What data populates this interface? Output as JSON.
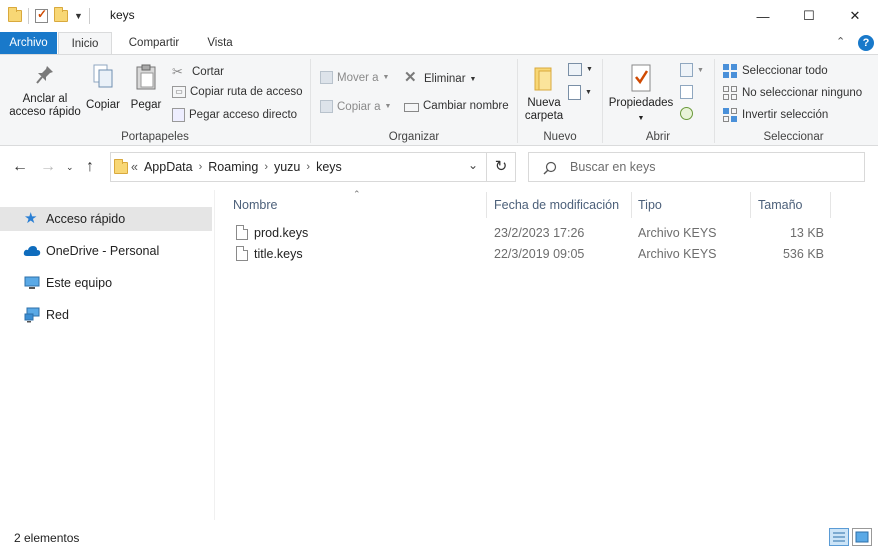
{
  "window": {
    "title": "keys",
    "controls": {
      "minimize": "—",
      "maximize": "☐",
      "close": "✕"
    }
  },
  "ribbon_tabs": [
    "Archivo",
    "Inicio",
    "Compartir",
    "Vista"
  ],
  "ribbon": {
    "portapapeles": {
      "label": "Portapapeles",
      "pin": "Anclar al acceso rápido",
      "pin_line1": "Anclar al",
      "pin_line2": "acceso rápido",
      "copy": "Copiar",
      "paste": "Pegar",
      "cut": "Cortar",
      "copy_path": "Copiar ruta de acceso",
      "paste_shortcut": "Pegar acceso directo"
    },
    "organizar": {
      "label": "Organizar",
      "move_to": "Mover a",
      "copy_to": "Copiar a",
      "delete": "Eliminar",
      "rename": "Cambiar nombre"
    },
    "nuevo": {
      "label": "Nuevo",
      "new_folder_line1": "Nueva",
      "new_folder_line2": "carpeta"
    },
    "abrir": {
      "label": "Abrir",
      "properties": "Propiedades"
    },
    "seleccionar": {
      "label": "Seleccionar",
      "select_all": "Seleccionar todo",
      "select_none": "No seleccionar ninguno",
      "invert": "Invertir selección"
    }
  },
  "address": {
    "crumbs": [
      "AppData",
      "Roaming",
      "yuzu",
      "keys"
    ],
    "overflow": "«",
    "search_placeholder": "Buscar en keys"
  },
  "nav": [
    {
      "label": "Acceso rápido",
      "icon": "star-icon",
      "active": true
    },
    {
      "label": "OneDrive - Personal",
      "icon": "cloud-icon",
      "active": false
    },
    {
      "label": "Este equipo",
      "icon": "computer-icon",
      "active": false
    },
    {
      "label": "Red",
      "icon": "network-icon",
      "active": false
    }
  ],
  "columns": [
    "Nombre",
    "Fecha de modificación",
    "Tipo",
    "Tamaño"
  ],
  "files": [
    {
      "name": "prod.keys",
      "modified": "23/2/2023 17:26",
      "type": "Archivo KEYS",
      "size": "13 KB"
    },
    {
      "name": "title.keys",
      "modified": "22/3/2019 09:05",
      "type": "Archivo KEYS",
      "size": "536 KB"
    }
  ],
  "status": {
    "count": "2 elementos"
  },
  "colors": {
    "accent": "#1979ca",
    "folder": "#f8d775",
    "selection": "#e5e5e5"
  }
}
